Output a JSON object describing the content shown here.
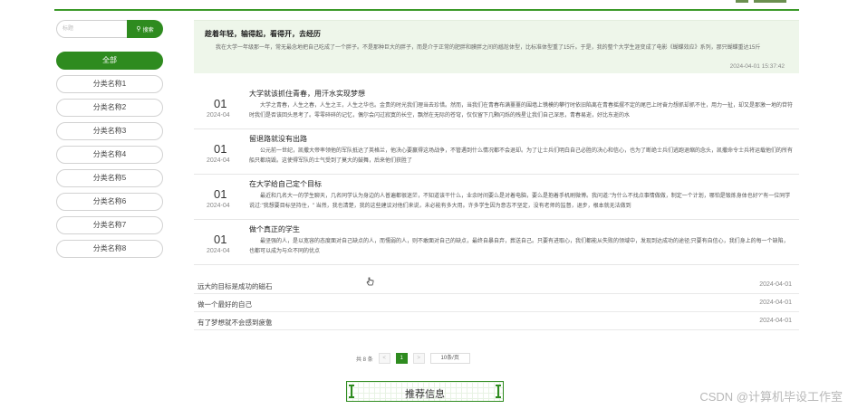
{
  "search": {
    "placeholder": "标题",
    "button_label": "搜索"
  },
  "categories": [
    {
      "label": "全部",
      "active": true
    },
    {
      "label": "分类名称1"
    },
    {
      "label": "分类名称2"
    },
    {
      "label": "分类名称3"
    },
    {
      "label": "分类名称4"
    },
    {
      "label": "分类名称5"
    },
    {
      "label": "分类名称6"
    },
    {
      "label": "分类名称7"
    },
    {
      "label": "分类名称8"
    }
  ],
  "featured": {
    "title": "趁着年轻，输得起，看得开，去经历",
    "body": "我在大学一年级那一年，常无最念地把自己吃成了一个胖子。不是那种巨大的胖子，而是介于正常的肥胖和膜胖之间的尴尬体型，比标准体型重了15斤。于是，我的整个大学生涯变成了电影《蝴蝶效应》系列，那只蝴蝶重达15斤",
    "date": "2024-04-01 15:37:42"
  },
  "articles": [
    {
      "day": "01",
      "ym": "2024-04",
      "title": "大学就该抓住青春，用汗水实现梦想",
      "body": "大学之青春，人生之春，人生之王，人生之华也。金贵的时光我们理当去珍惜。然而，当我们在青春布满薹薹的围墙上镌模的攀行时依旧陷离在青春摇摆不定的尾巴上时奋力想抓却抓不住，用力一扯，却又是那激一地的苷符时我们是否该回头思考了。零零碎碎的记忆，偶尔会闪过寂寞的长空，飘然在无际的苍穹，仅仅留下几颗闪烁的残星让我们自己深思，青春易逝，好比东逝的水"
    },
    {
      "day": "01",
      "ym": "2024-04",
      "title": "留退路就没有出路",
      "body": "公元前一世纪，凯撒大帝率领他的军队抵达了英格兰，他决心要赢得这场战争，不管遇到什么情况都不会退却。为了让士兵们明白自己必胜的决心和信心，也为了断绝士兵们逃跑退缩的念头，凯撒命令士兵将运载他们的所有船只都烧毁。这使得军队的士气受到了莫大的鼓舞，后来他们获胜了"
    },
    {
      "day": "01",
      "ym": "2024-04",
      "title": "在大学给自己定个目标",
      "body": "最近和几名大一的学生聊天，几名同学认为身边的人普遍都很迷茫，不知道该干什么，业余时间要么是对着电脑，要么是抱着手机刷微博。我问道:\"为什么不找点事情做做，制定一个计划，哪怕是锻炼身体也好?\"有一位同学说过:\"我想要目标坚持住，\" 当然，我也清楚，我的这些建议对他们来说，未必能有多大用。许多学生因为意志不坚定，没有老师的监督，退步，根本就无法做到"
    },
    {
      "day": "01",
      "ym": "2024-04",
      "title": "做个真正的学生",
      "body": "最坚强的人，是以宽容的态度面对自己缺点的人，而懦弱的人，则不敢面对自己的缺点，最终自暴自弃，葬送自己。只要有进取心，我们都能从失败的领域中，发现到达成功的途径;只要有自信心，我们身上的每一个缺陷，也都可以成为与众不同的优点"
    }
  ],
  "plain_list": [
    {
      "title": "远大的目标是成功的磁石",
      "date": "2024-04-01"
    },
    {
      "title": "做一个最好的自己",
      "date": "2024-04-01"
    },
    {
      "title": "有了梦想就不会感到疲惫",
      "date": "2024-04-01"
    }
  ],
  "pager": {
    "total": "共 8 条",
    "prev": "<",
    "current": "1",
    "next": ">",
    "page_size": "10条/页"
  },
  "recommend": {
    "title": "推荐信息"
  },
  "watermark": "CSDN @计算机毕设工作室",
  "colors": {
    "accent": "#2e8b1f",
    "featured_bg": "#eef6ea"
  }
}
